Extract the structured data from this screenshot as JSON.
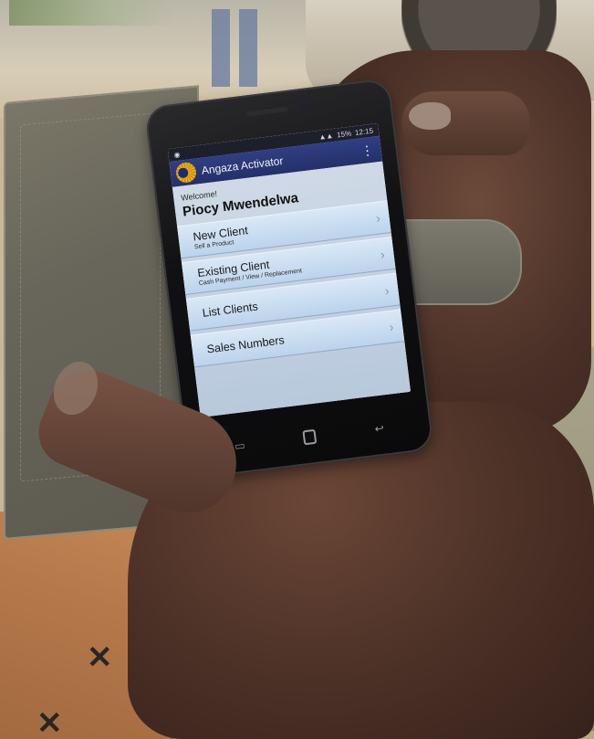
{
  "status_bar": {
    "left_icon": "notification-icon",
    "signal": "▲▲",
    "battery": "15%",
    "time": "12:15"
  },
  "app_bar": {
    "title": "Angaza Activator",
    "logo_icon": "sun-logo-icon",
    "menu_icon": "overflow-menu-icon"
  },
  "welcome": {
    "greeting": "Welcome!",
    "name": "Piocy Mwendelwa"
  },
  "menu": [
    {
      "title": "New Client",
      "subtitle": "Sell a Product"
    },
    {
      "title": "Existing Client",
      "subtitle": "Cash Payment / View / Replacement"
    },
    {
      "title": "List Clients",
      "subtitle": ""
    },
    {
      "title": "Sales Numbers",
      "subtitle": ""
    }
  ],
  "nav_bar": [
    "back",
    "home",
    "recents"
  ],
  "colors": {
    "app_bar": "#2f3f83",
    "menu_item": "#c9dcf0",
    "logo": "#f2b21b"
  }
}
